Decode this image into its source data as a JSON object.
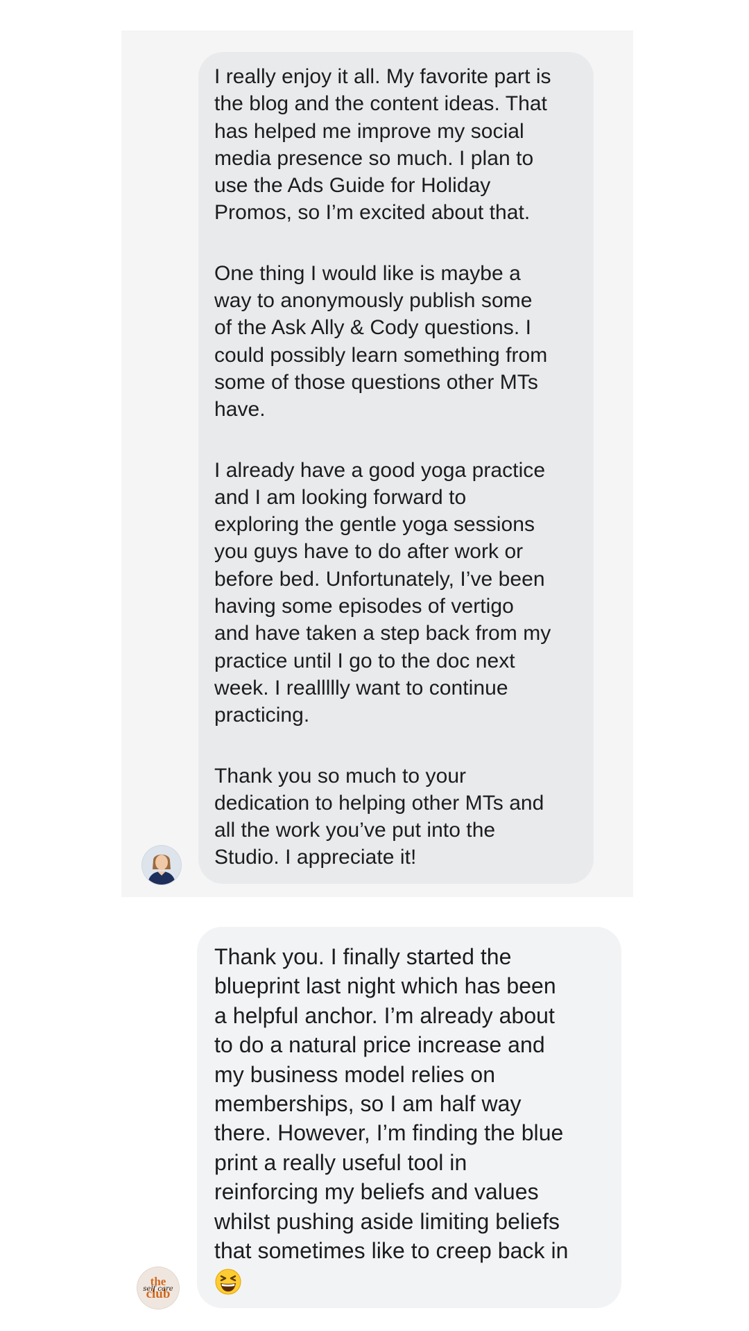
{
  "thread": {
    "messages": [
      {
        "paragraphs": [
          "I really enjoy it all. My favorite part is\nthe blog and the content ideas. That\nhas helped me improve my social\nmedia presence so much. I plan to\nuse the Ads Guide for Holiday\nPromos, so I’m excited about that.",
          "One thing I would like is maybe a\nway to anonymously publish some\nof the Ask Ally & Cody questions. I\ncould possibly learn something from\nsome of those questions other MTs\nhave.",
          "I already have a good yoga practice\nand I am looking forward to\nexploring the gentle yoga sessions\nyou guys have to do after work or\nbefore bed. Unfortunately, I’ve been\nhaving some episodes of vertigo\nand have taken a step back from my\npractice until I go to the doc next\nweek. I reallllly want to continue\npracticing.",
          "Thank you so much to your\ndedication to helping other MTs and\nall the work you’ve put into the\nStudio. I appreciate it!"
        ],
        "avatar": "person-avatar"
      },
      {
        "paragraphs": [
          "Thank you. I finally started the\nblueprint last night which has been\na helpful anchor. I’m already about\nto do a natural price increase and\nmy business model relies on\nmemberships, so I am half way\nthere. However, I’m finding the blue\nprint a really useful tool in\nreinforcing my beliefs and values\nwhilst pushing aside limiting beliefs\nthat sometimes like to creep back in"
        ],
        "emoji": "grinning-squinting-face",
        "avatar": "the-self-care-club-logo",
        "avatar_logo_text": "the self care club"
      }
    ]
  },
  "colors": {
    "panel_background": "#f5f5f6",
    "bubble_1_background": "#e9eaec",
    "bubble_2_background": "#f2f3f5",
    "text": "#1c1c1e",
    "logo_orange": "#d2691e"
  }
}
